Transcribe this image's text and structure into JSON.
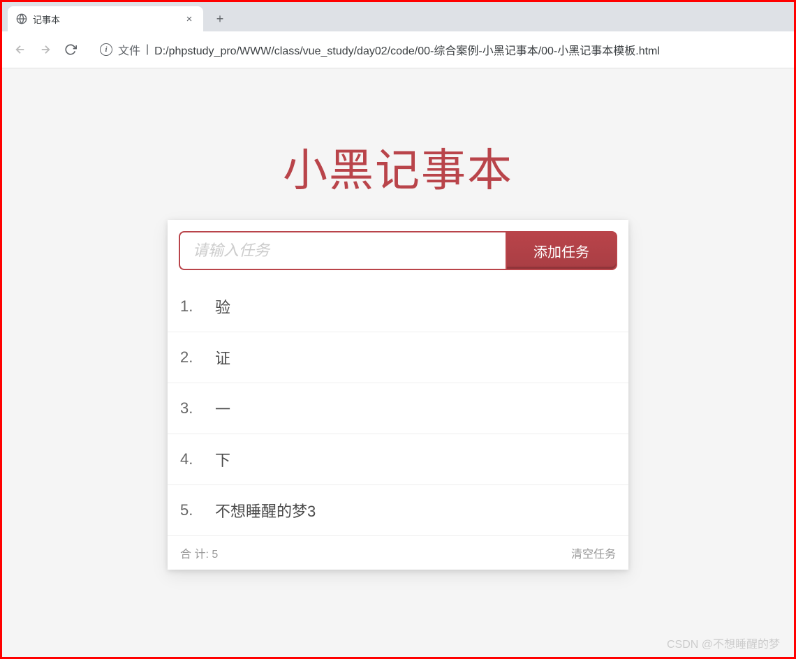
{
  "browser": {
    "tab_title": "记事本",
    "file_label": "文件",
    "url": "D:/phpstudy_pro/WWW/class/vue_study/day02/code/00-综合案例-小黑记事本/00-小黑记事本模板.html"
  },
  "app": {
    "title": "小黑记事本",
    "input_placeholder": "请输入任务",
    "add_button_label": "添加任务",
    "tasks": [
      {
        "index": "1.",
        "text": "验"
      },
      {
        "index": "2.",
        "text": "证"
      },
      {
        "index": "3.",
        "text": "一"
      },
      {
        "index": "4.",
        "text": "下"
      },
      {
        "index": "5.",
        "text": "不想睡醒的梦3"
      }
    ],
    "footer": {
      "count_label": "合 计:",
      "count_value": "5",
      "clear_label": "清空任务"
    }
  },
  "watermark": "CSDN @不想睡醒的梦",
  "colors": {
    "accent": "#b9444a",
    "page_bg": "#f5f5f5"
  }
}
